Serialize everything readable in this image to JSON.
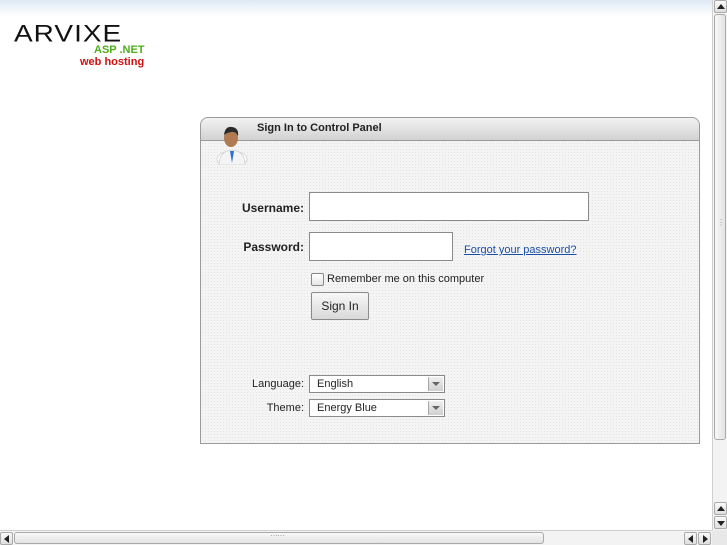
{
  "logo": {
    "main": "ARVIXE",
    "line1": "ASP .NET",
    "line2": "web hosting"
  },
  "panel": {
    "title": "Sign In to Control Panel",
    "icon": "user-icon"
  },
  "form": {
    "username_label": "Username:",
    "username_value": "",
    "password_label": "Password:",
    "password_value": "",
    "forgot_link": "Forgot your password?",
    "remember_label": "Remember me on this computer",
    "remember_checked": false,
    "signin_label": "Sign In",
    "language_label": "Language:",
    "language_value": "English",
    "theme_label": "Theme:",
    "theme_value": "Energy Blue"
  },
  "colors": {
    "link": "#1a4fa8",
    "logo_green": "#4cae1a",
    "logo_red": "#d01010"
  }
}
